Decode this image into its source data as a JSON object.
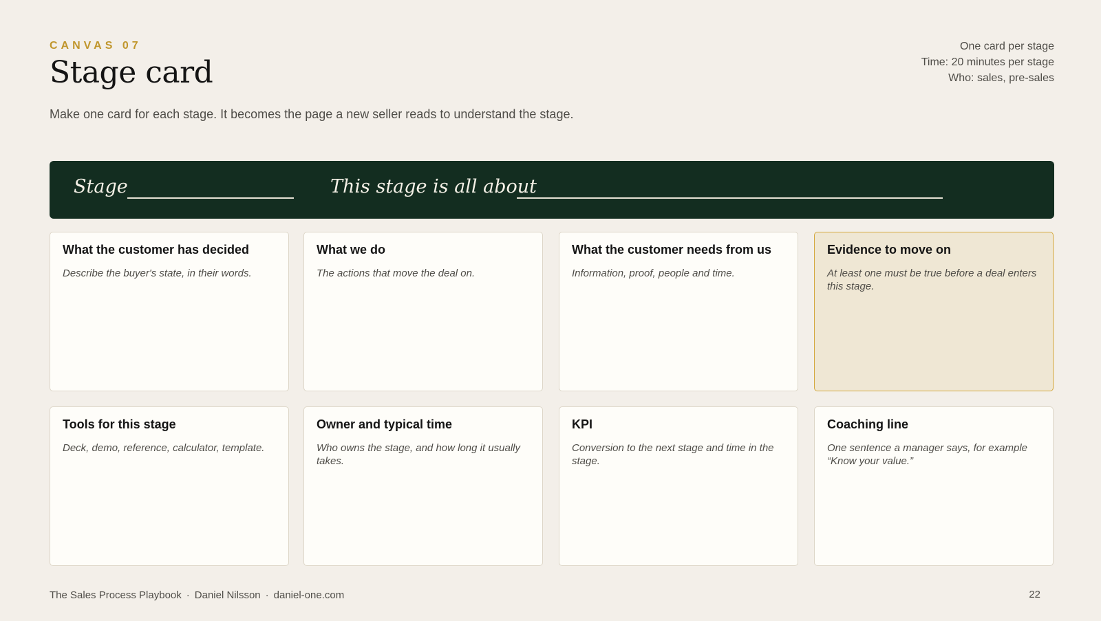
{
  "header": {
    "eyebrow": "CANVAS 07",
    "title": "Stage card",
    "subtitle": "Make one card for each stage. It becomes the page a new seller reads to understand the stage.",
    "meta": [
      "One card per stage",
      "Time: 20 minutes per stage",
      "Who: sales, pre-sales"
    ]
  },
  "banner": {
    "stage_label": "Stage",
    "about_label": "This stage is all about"
  },
  "cards": [
    {
      "title": "What the customer has decided",
      "desc": "Describe the buyer's state, in their words."
    },
    {
      "title": "What we do",
      "desc": "The actions that move the deal on."
    },
    {
      "title": "What the customer needs from us",
      "desc": "Information, proof, people and time."
    },
    {
      "title": "Evidence to move on",
      "desc": "At least one must be true before a deal enters this stage."
    },
    {
      "title": "Tools for this stage",
      "desc": "Deck, demo, reference, calculator, template."
    },
    {
      "title": "Owner and typical time",
      "desc": "Who owns the stage, and how long it usually takes."
    },
    {
      "title": "KPI",
      "desc": "Conversion to the next stage and time in the stage."
    },
    {
      "title": "Coaching line",
      "desc": "One sentence a manager says, for example “Know your value.”"
    }
  ],
  "footer": {
    "book": "The Sales Process Playbook",
    "author": "Daniel Nilsson",
    "site": "daniel-one.com",
    "separator": "·",
    "page_number": "22"
  },
  "colors": {
    "background": "#f3efe9",
    "accent_gold": "#c0962c",
    "banner_green": "#132d20",
    "highlight_card": "#efe7d4"
  }
}
